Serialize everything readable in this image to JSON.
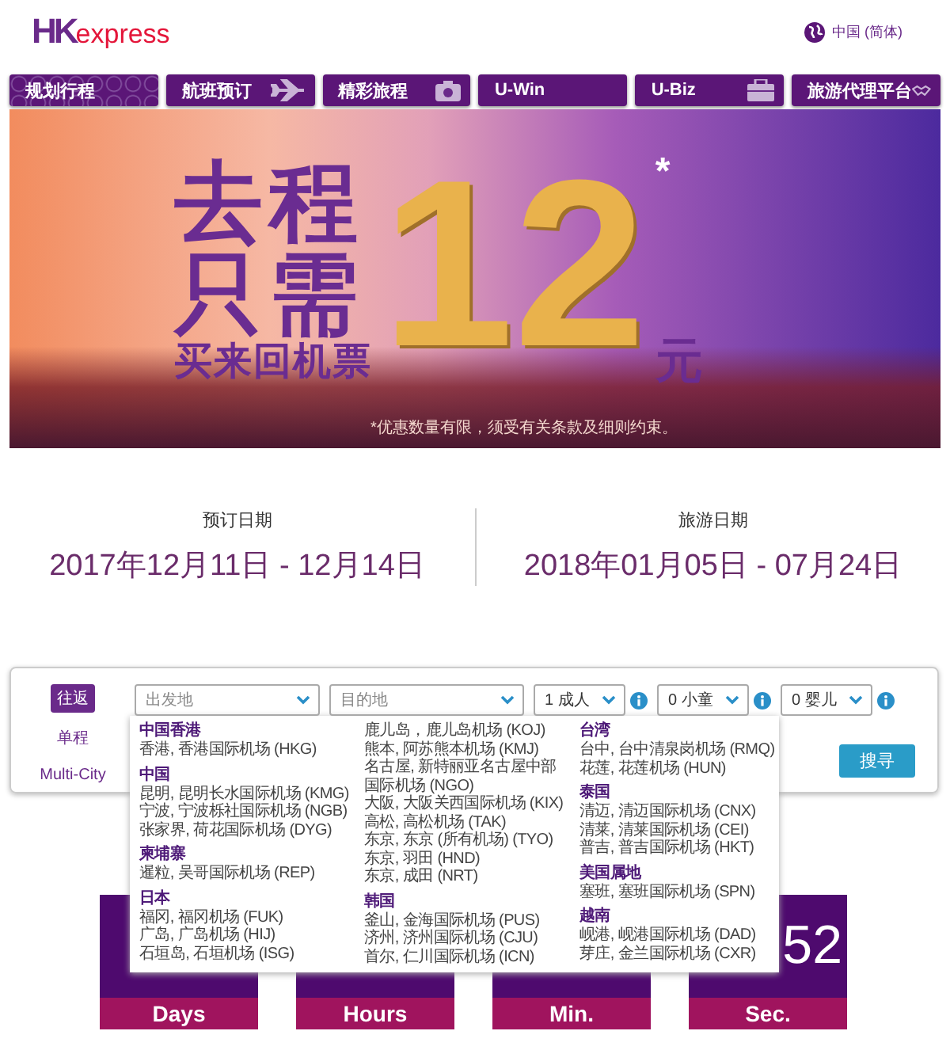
{
  "header": {
    "logo": {
      "mark": "HK",
      "word": "express"
    },
    "language": "中国 (简体)"
  },
  "nav": [
    {
      "label": "规划行程",
      "selected": true
    },
    {
      "label": "航班预订",
      "selected": false
    },
    {
      "label": "精彩旅程",
      "selected": false
    },
    {
      "label": "U-Win",
      "selected": false
    },
    {
      "label": "U-Biz",
      "selected": false
    },
    {
      "label": "旅游代理平台",
      "selected": false
    }
  ],
  "banner": {
    "line_1": "去程",
    "line_2": "只需",
    "line_3": "买来回机票",
    "price": "12",
    "asterisk": "*",
    "currency": "元",
    "footnote": "*优惠数量有限，须受有关条款及细则约束。"
  },
  "dates": [
    {
      "label": "预订日期",
      "value": "2017年12月11日 - 12月14日"
    },
    {
      "label": "旅游日期",
      "value": "2018年01月05日 - 07月24日"
    }
  ],
  "search": {
    "trip_types": [
      {
        "label": "往返",
        "selected": true
      },
      {
        "label": "单程",
        "selected": false
      },
      {
        "label": "Multi-City",
        "selected": false
      }
    ],
    "origin": {
      "placeholder": "出发地"
    },
    "destination": {
      "placeholder": "目的地"
    },
    "passengers": [
      {
        "value": "1 成人"
      },
      {
        "value": "0 小童"
      },
      {
        "value": "0 婴儿"
      }
    ],
    "button": "搜寻"
  },
  "origin_dropdown": {
    "columns": [
      [
        {
          "heading": "中国香港",
          "items": [
            "香港, 香港国际机场 (HKG)"
          ]
        },
        {
          "heading": "中国",
          "items": [
            "昆明, 昆明长水国际机场 (KMG)",
            "宁波, 宁波栎社国际机场 (NGB)",
            "张家界, 荷花国际机场 (DYG)"
          ]
        },
        {
          "heading": "柬埔寨",
          "items": [
            "暹粒, 吴哥国际机场 (REP)"
          ]
        },
        {
          "heading": "日本",
          "items": [
            "福冈, 福冈机场 (FUK)",
            "广岛, 广岛机场 (HIJ)",
            "石垣岛, 石垣机场 (ISG)"
          ]
        }
      ],
      [
        {
          "items": [
            "鹿儿岛，鹿儿岛机场 (KOJ)",
            "熊本, 阿苏熊本机场 (KMJ)",
            "名古屋, 新特丽亚名古屋中部国际机场 (NGO)",
            "大阪, 大阪关西国际机场 (KIX)",
            "高松, 高松机场 (TAK)",
            "东京, 东京 (所有机场) (TYO)",
            "东京, 羽田 (HND)",
            "东京, 成田 (NRT)"
          ]
        },
        {
          "heading": "韩国",
          "items": [
            "釜山, 金海国际机场 (PUS)",
            "济州, 济州国际机场 (CJU)",
            "首尔, 仁川国际机场 (ICN)"
          ]
        }
      ],
      [
        {
          "heading": "台湾",
          "items": [
            "台中, 台中清泉岗机场 (RMQ)",
            "花莲, 花莲机场 (HUN)"
          ]
        },
        {
          "heading": "泰国",
          "items": [
            "清迈, 清迈国际机场 (CNX)",
            "清莱, 清莱国际机场 (CEI)",
            "普吉, 普吉国际机场 (HKT)"
          ]
        },
        {
          "heading": "美国属地",
          "items": [
            "塞班, 塞班国际机场 (SPN)"
          ]
        },
        {
          "heading": "越南",
          "items": [
            "岘港, 岘港国际机场 (DAD)",
            "芽庄, 金兰国际机场 (CXR)"
          ]
        }
      ]
    ]
  },
  "countdown": [
    {
      "label": "Days"
    },
    {
      "label": "Hours"
    },
    {
      "label": "Min."
    },
    {
      "label": "Sec.",
      "value": "52"
    }
  ]
}
